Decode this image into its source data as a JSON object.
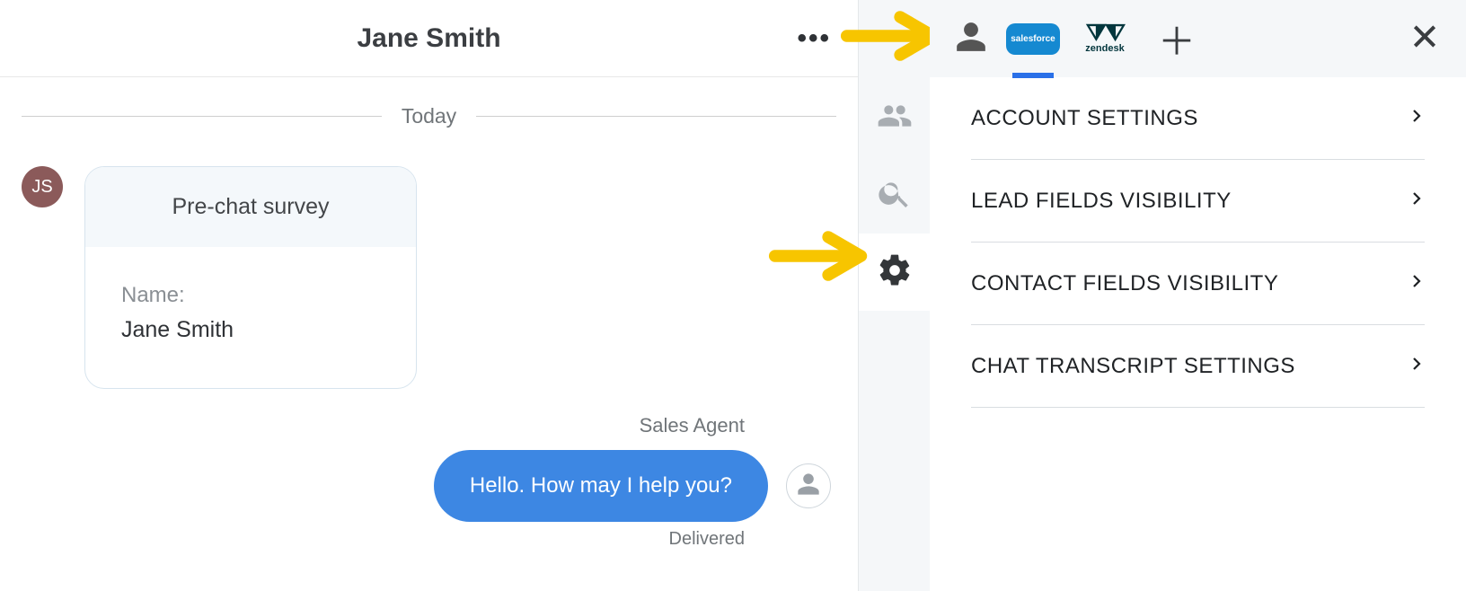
{
  "header": {
    "title": "Jane Smith"
  },
  "chat": {
    "day_label": "Today",
    "avatar_initials": "JS",
    "survey": {
      "title": "Pre-chat survey",
      "name_label": "Name:",
      "name_value": "Jane Smith"
    },
    "agent_name": "Sales Agent",
    "outgoing_text": "Hello. How may I help you?",
    "status": "Delivered"
  },
  "integrations": {
    "salesforce": "salesforce",
    "zendesk": "zendesk"
  },
  "settings_menu": {
    "items": [
      {
        "label": "ACCOUNT SETTINGS"
      },
      {
        "label": "LEAD FIELDS VISIBILITY"
      },
      {
        "label": "CONTACT FIELDS VISIBILITY"
      },
      {
        "label": "CHAT TRANSCRIPT SETTINGS"
      }
    ]
  }
}
